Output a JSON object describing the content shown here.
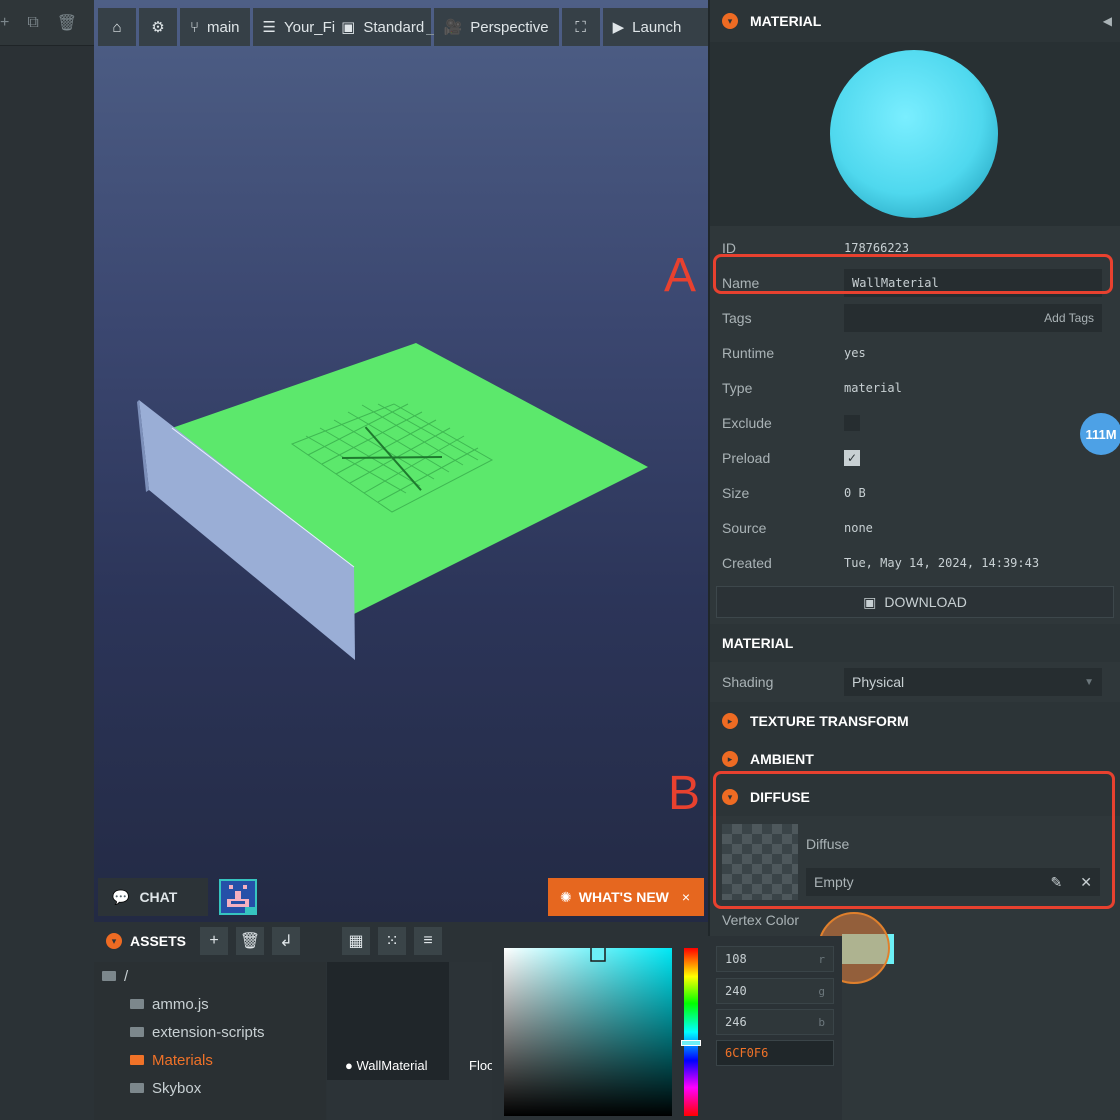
{
  "viewport_toolbar": {
    "home_icon": "home-icon",
    "settings_icon": "gear-icon",
    "branch_label": "main",
    "scene_label": "Your_Fi",
    "scene_label_overlap": "_App",
    "render_mode_label": "Standard",
    "camera_label": "Perspective",
    "launch_label": "Launch"
  },
  "chat": {
    "label": "CHAT"
  },
  "whats_new": {
    "label": "WHAT'S NEW",
    "close": "×"
  },
  "assets": {
    "title": "ASSETS",
    "tree": [
      {
        "label": "/"
      },
      {
        "label": "ammo.js"
      },
      {
        "label": "extension-scripts"
      },
      {
        "label": "Materials",
        "active": true
      },
      {
        "label": "Skybox"
      }
    ],
    "cards": [
      {
        "label": "WallMaterial"
      },
      {
        "label": "Floo"
      }
    ]
  },
  "inspector": {
    "material_header": "MATERIAL",
    "rows": {
      "id": {
        "key": "ID",
        "value": "178766223"
      },
      "name": {
        "key": "Name",
        "value": "WallMaterial"
      },
      "tags": {
        "key": "Tags",
        "button": "Add Tags"
      },
      "runtime": {
        "key": "Runtime",
        "value": "yes"
      },
      "type": {
        "key": "Type",
        "value": "material"
      },
      "exclude": {
        "key": "Exclude"
      },
      "preload": {
        "key": "Preload",
        "checked": true
      },
      "size": {
        "key": "Size",
        "value": "0 B"
      },
      "source": {
        "key": "Source",
        "value": "none"
      },
      "created": {
        "key": "Created",
        "value": "Tue, May 14, 2024, 14:39:43"
      }
    },
    "download_label": "DOWNLOAD",
    "material_section": "MATERIAL",
    "shading": {
      "key": "Shading",
      "value": "Physical"
    },
    "texture_transform": "TEXTURE TRANSFORM",
    "ambient": "AMBIENT",
    "diffuse": {
      "header": "DIFFUSE",
      "slot_label": "Diffuse",
      "slot_value": "Empty"
    },
    "vertex_color_label": "Vertex Color"
  },
  "vram_badge": "111M",
  "color_picker": {
    "r": "108",
    "g": "240",
    "b": "246",
    "r_ch": "r",
    "g_ch": "g",
    "b_ch": "b",
    "hex": "6CF0F6"
  },
  "annotations": {
    "a": "A",
    "b": "B"
  },
  "colors": {
    "accent": "#ee6b23",
    "annotation": "#e8412f",
    "floor": "#5ce86c",
    "sphere": "#56e0f4",
    "diffuse_swatch": "#6cf0f6"
  }
}
